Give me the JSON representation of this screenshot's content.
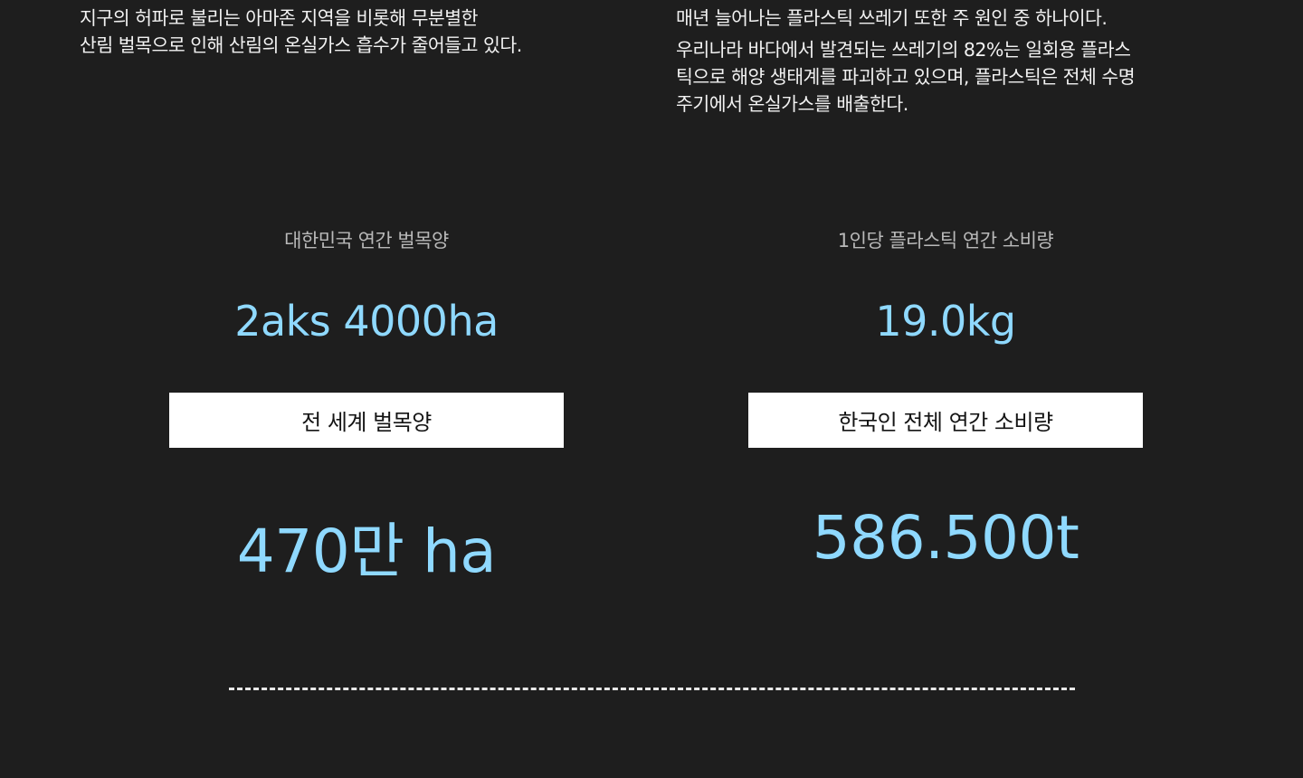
{
  "left": {
    "description": [
      "지구의 허파로 불리는 아마존 지역을 비롯해 무분별한",
      "산림 벌목으로 인해 산림의 온실가스 흡수가 줄어들고 있다."
    ],
    "stat_label": "대한민국 연간 벌목양",
    "stat_value": "2aks 4000ha",
    "button_label": "전 세계 벌목양",
    "big_value": "470만 ha"
  },
  "right": {
    "description": [
      "매년 늘어나는 플라스틱 쓰레기 또한 주 원인 중 하나이다.",
      "우리나라 바다에서 발견되는 쓰레기의 82%는 일회용 플라스",
      "틱으로 해양 생태계를 파괴하고 있으며, 플라스틱은 전체 수명",
      "주기에서 온실가스를 배출한다."
    ],
    "stat_label": "1인당 플라스틱 연간 소비량",
    "stat_value": "19.0kg",
    "button_label": "한국인 전체 연간 소비량",
    "big_value": "586.500t"
  },
  "colors": {
    "background": "#1e1e1e",
    "accent": "#8fd9ff",
    "label_gray": "#b9b9b9",
    "button_bg": "#ffffff",
    "button_text": "#141414"
  }
}
